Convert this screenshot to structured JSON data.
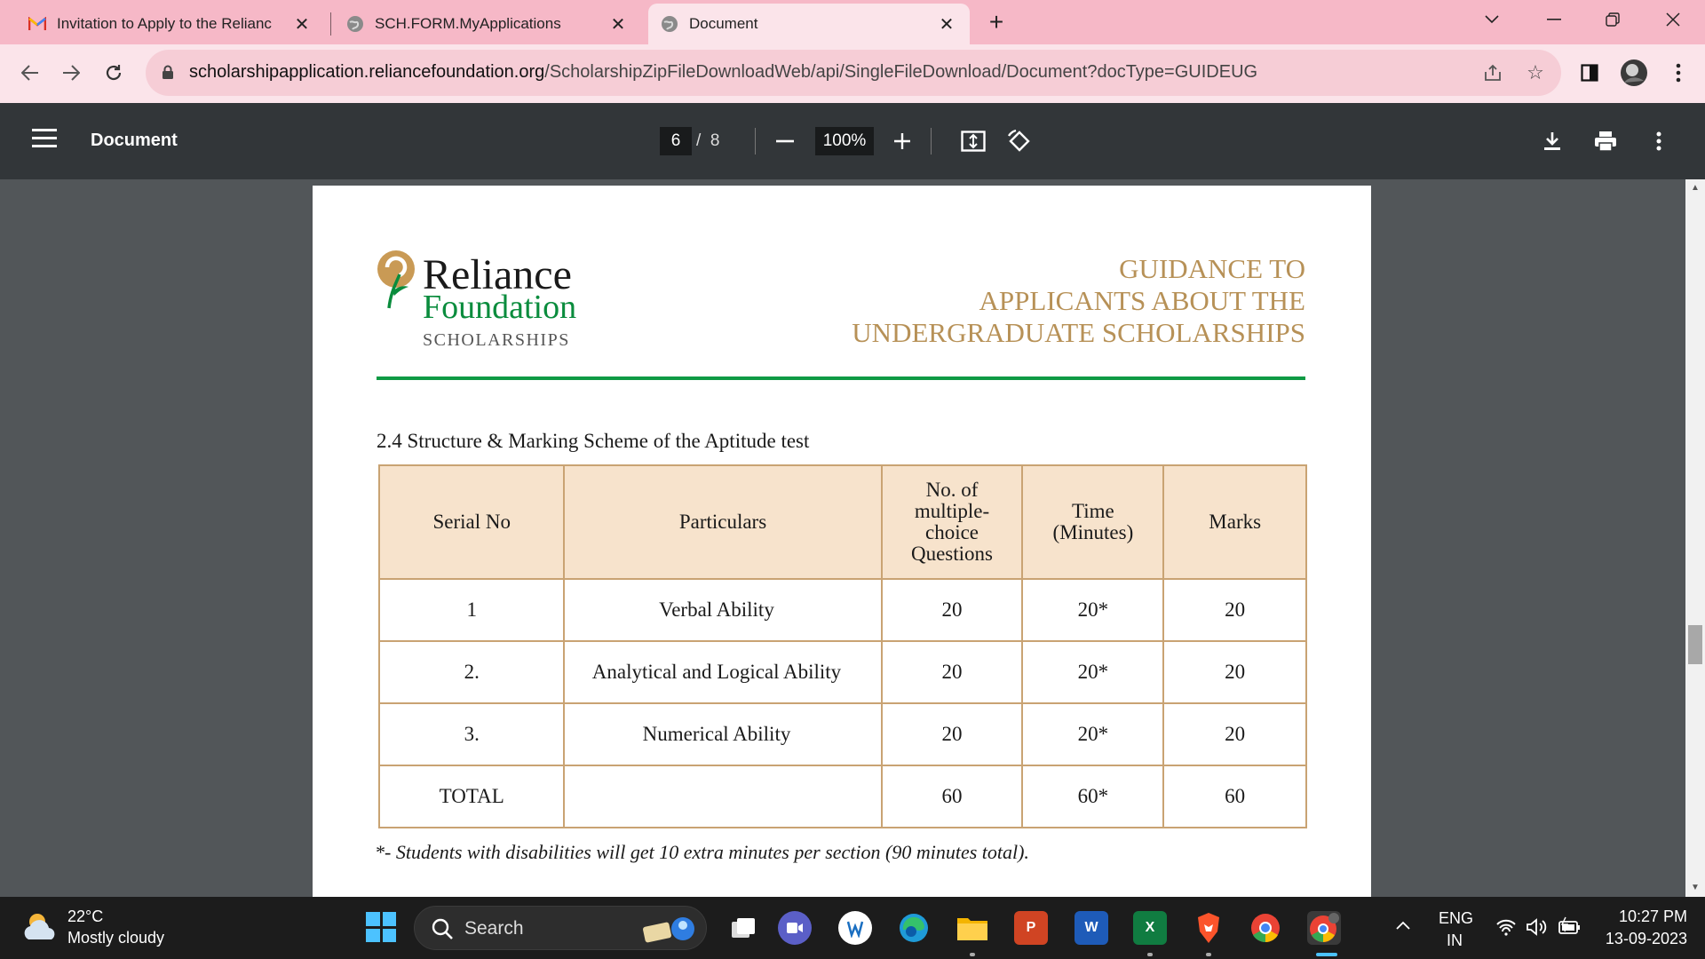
{
  "browser": {
    "tabs": [
      {
        "title": "Invitation to Apply to the Relianc",
        "icon": "gmail-icon",
        "active": false
      },
      {
        "title": "SCH.FORM.MyApplications",
        "icon": "globe-icon",
        "active": false
      },
      {
        "title": "Document",
        "icon": "globe-icon",
        "active": true
      }
    ],
    "new_tab_label": "+",
    "url_domain": "scholarshipapplication.reliancefoundation.org",
    "url_path": "/ScholarshipZipFileDownloadWeb/api/SingleFileDownload/Document?docType=GUIDEUG"
  },
  "pdf_toolbar": {
    "title": "Document",
    "current_page": "6",
    "page_separator": "/",
    "total_pages": "8",
    "zoom": "100%"
  },
  "document": {
    "logo": {
      "line1": "Reliance",
      "line2": "Foundation",
      "line3": "SCHOLARSHIPS"
    },
    "guidance_title": [
      "GUIDANCE TO",
      "APPLICANTS ABOUT THE",
      "UNDERGRADUATE SCHOLARSHIPS"
    ],
    "section_title": "2.4 Structure & Marking Scheme of the Aptitude test",
    "table": {
      "headers": [
        "Serial No",
        "Particulars",
        "No. of multiple-choice Questions",
        "Time (Minutes)",
        "Marks"
      ],
      "rows": [
        [
          "1",
          "Verbal Ability",
          "20",
          "20*",
          "20"
        ],
        [
          "2.",
          "Analytical and Logical Ability",
          "20",
          "20*",
          "20"
        ],
        [
          "3.",
          "Numerical Ability",
          "20",
          "20*",
          "20"
        ],
        [
          "TOTAL",
          "",
          "60",
          "60*",
          "60"
        ]
      ]
    },
    "footnote": "*- Students with disabilities will get 10 extra minutes per section (90 minutes total)."
  },
  "taskbar": {
    "weather_temp": "22°C",
    "weather_desc": "Mostly cloudy",
    "search_label": "Search",
    "lang_line1": "ENG",
    "lang_line2": "IN",
    "time": "10:27 PM",
    "date": "13-09-2023"
  },
  "colors": {
    "tab_bar": "#f6b8c7",
    "pdf_toolbar": "#323639",
    "table_border": "#c9a373",
    "table_header_bg": "#f7e3cc",
    "brand_gold": "#b79157",
    "brand_green": "#0f9a44"
  }
}
